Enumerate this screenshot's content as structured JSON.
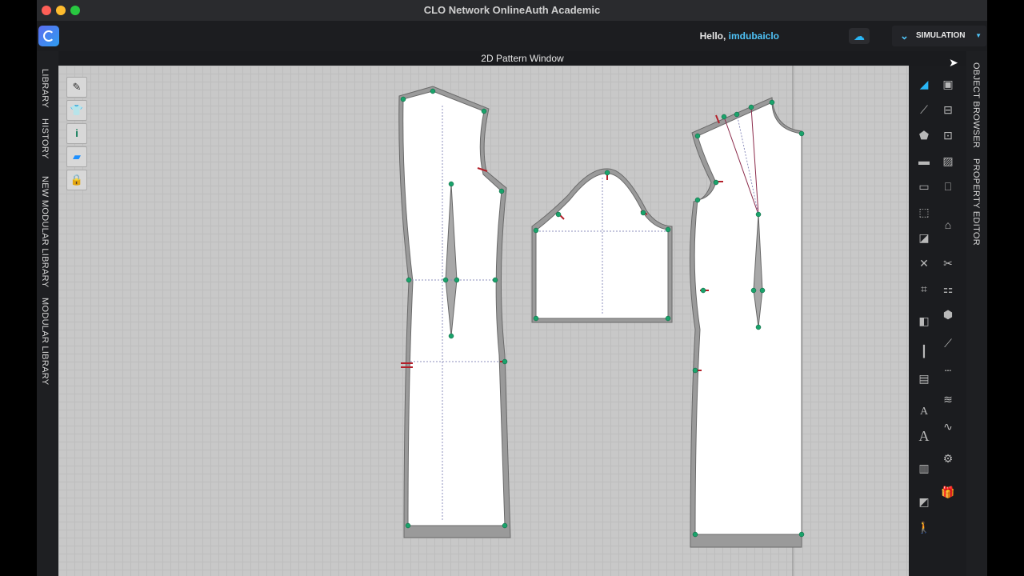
{
  "window": {
    "title": "CLO Network OnlineAuth Academic"
  },
  "header": {
    "greeting": "Hello,",
    "username": "imdubaiclo",
    "mode_label": "SIMULATION"
  },
  "pattern_window": {
    "title": "2D Pattern Window"
  },
  "left_tabs": [
    "LIBRARY",
    "HISTORY",
    "NEW MODULAR LIBRARY",
    "MODULAR LIBRARY"
  ],
  "right_tabs": [
    "OBJECT BROWSER",
    "PROPERTY EDITOR"
  ],
  "colors": {
    "accent": "#4fc3f7",
    "point": "#1aa36b",
    "notch": "#b3202a",
    "canvas": "#c8c8c8"
  },
  "icons": {
    "left_tools": [
      "show-pattern-line-icon",
      "show-garment-icon",
      "info-icon",
      "pattern-fill-icon",
      "lock-icon"
    ],
    "right_tools": [
      "transform-pattern-icon",
      "edit-point-icon",
      "edit-curve-icon",
      "polygon-icon",
      "rectangle-icon",
      "internal-rectangle-icon",
      "dart-icon",
      "trace-icon",
      "segment-sewing-icon",
      "fold-icon",
      "measure-icon",
      "text-icon",
      "annotation-icon",
      "grain-icon",
      "avatar-icon"
    ]
  }
}
